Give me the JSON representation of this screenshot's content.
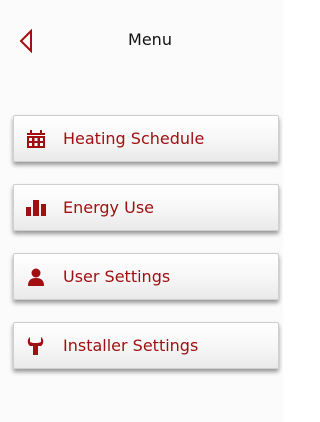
{
  "header": {
    "title": "Menu",
    "back_icon": "back-triangle-icon"
  },
  "colors": {
    "accent": "#a10f12",
    "background": "#fbfbfb"
  },
  "menu": {
    "items": [
      {
        "label": "Heating Schedule",
        "icon": "calendar-icon"
      },
      {
        "label": "Energy Use",
        "icon": "bar-chart-icon"
      },
      {
        "label": "User Settings",
        "icon": "user-icon"
      },
      {
        "label": "Installer Settings",
        "icon": "wrench-icon"
      }
    ]
  }
}
